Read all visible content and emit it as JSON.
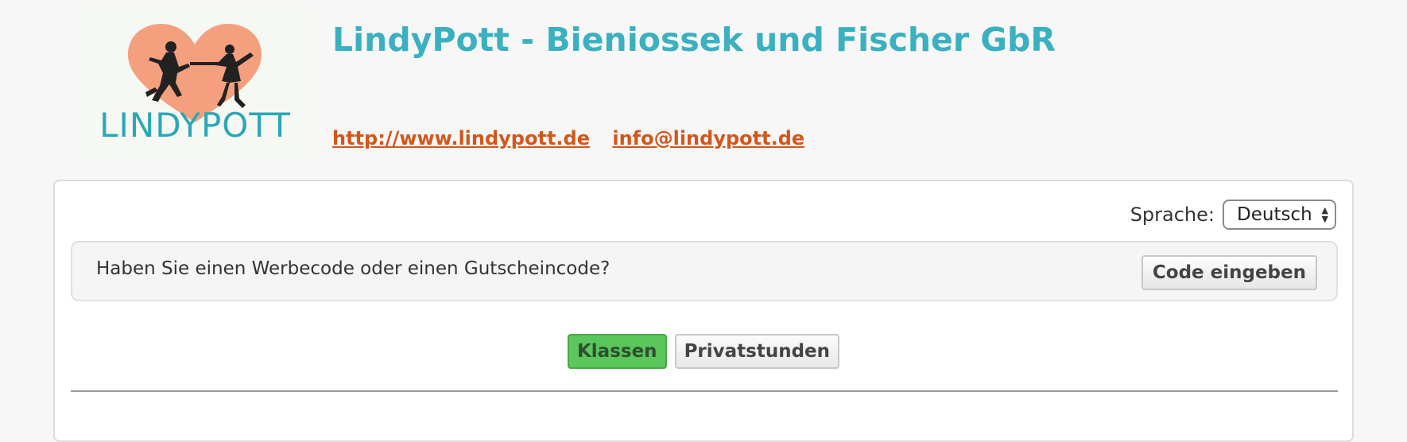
{
  "header": {
    "logo_text": "LINDYPOTT",
    "company_title": "LindyPott - Bieniossek und Fischer GbR",
    "website_link": "http://www.lindypott.de",
    "email_link": "info@lindypott.de"
  },
  "language": {
    "label": "Sprache:",
    "selected": "Deutsch"
  },
  "coupon": {
    "question": "Haben Sie einen Werbecode oder einen Gutscheincode?",
    "button_label": "Code eingeben"
  },
  "tabs": [
    {
      "label": "Klassen",
      "active": true
    },
    {
      "label": "Privatstunden",
      "active": false
    }
  ],
  "colors": {
    "title": "#3ab0c0",
    "link": "#d4561a",
    "heart": "#f4a07f",
    "logo_text": "#2aa7b8",
    "active_tab": "#5bc65b"
  }
}
